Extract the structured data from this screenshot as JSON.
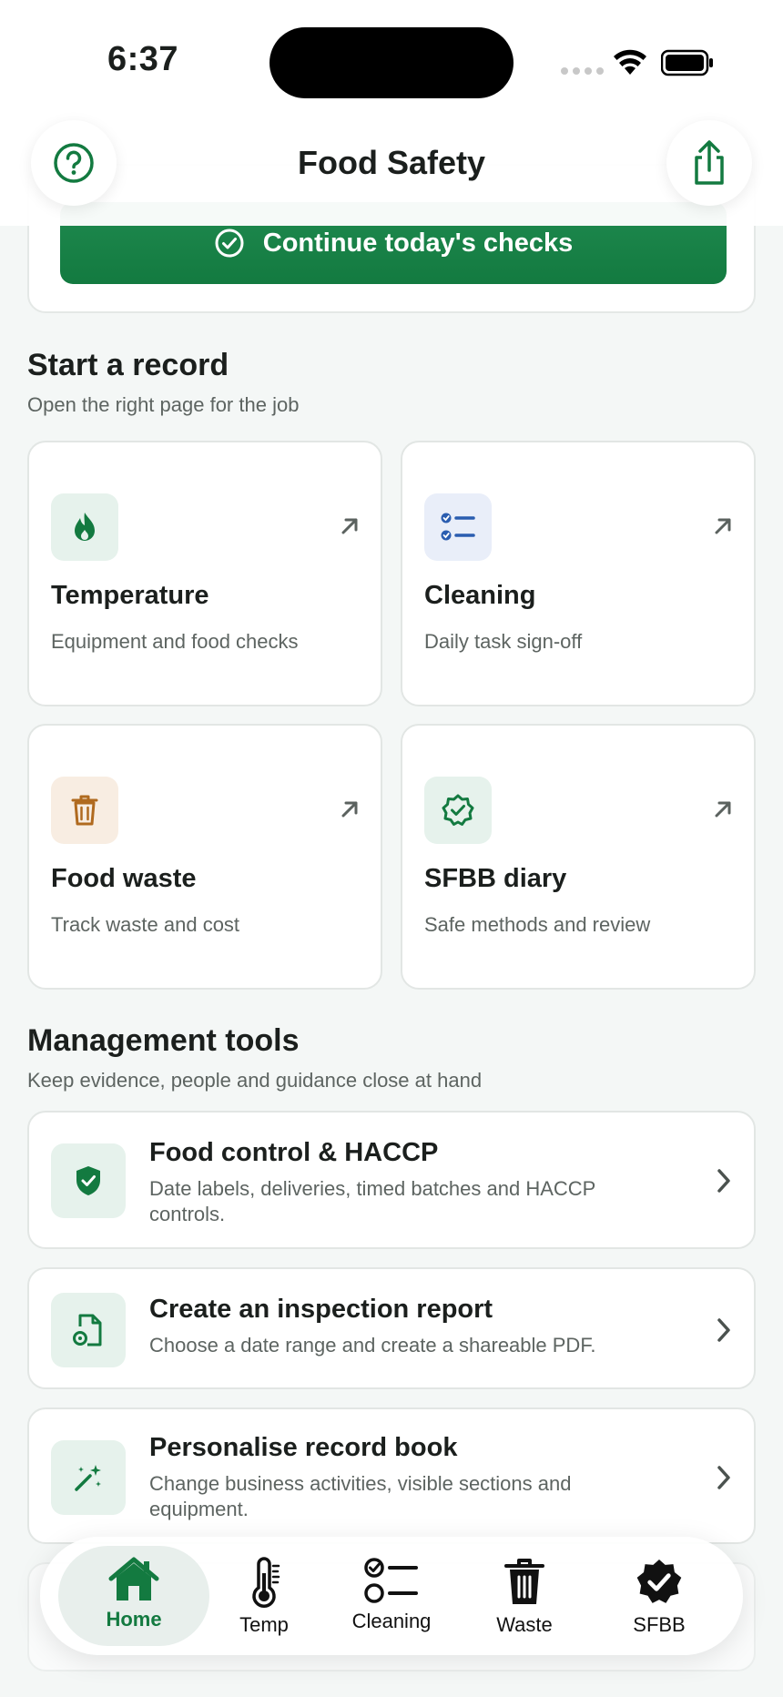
{
  "status": {
    "time": "6:37"
  },
  "header": {
    "title": "Food Safety"
  },
  "top_card": {
    "continue_label": "Continue today's checks"
  },
  "start_section": {
    "title": "Start a record",
    "subtitle": "Open the right page for the job",
    "tiles": [
      {
        "title": "Temperature",
        "subtitle": "Equipment and food checks",
        "icon": "flame-icon",
        "icon_bg": "#e6f2ec",
        "icon_color": "#137a40"
      },
      {
        "title": "Cleaning",
        "subtitle": "Daily task sign-off",
        "icon": "checklist-icon",
        "icon_bg": "#e9eef9",
        "icon_color": "#2a5db0"
      },
      {
        "title": "Food waste",
        "subtitle": "Track waste and cost",
        "icon": "bin-icon",
        "icon_bg": "#f8ede2",
        "icon_color": "#b06a1f"
      },
      {
        "title": "SFBB diary",
        "subtitle": "Safe methods and review",
        "icon": "verified-badge-icon",
        "icon_bg": "#e6f2ec",
        "icon_color": "#137a40"
      }
    ]
  },
  "management": {
    "title": "Management tools",
    "subtitle": "Keep evidence, people and guidance close at hand",
    "items": [
      {
        "title": "Food control & HACCP",
        "desc": "Date labels, deliveries, timed batches and HACCP controls.",
        "icon": "shield-check-icon"
      },
      {
        "title": "Create an inspection report",
        "desc": "Choose a date range and create a shareable PDF.",
        "icon": "document-gear-icon"
      },
      {
        "title": "Personalise record book",
        "desc": "Change business activities, visible sections and equipment.",
        "icon": "magic-wand-icon"
      }
    ]
  },
  "tabbar": {
    "tabs": [
      {
        "label": "Home",
        "icon": "house-icon",
        "active": true
      },
      {
        "label": "Temp",
        "icon": "thermometer-icon",
        "active": false
      },
      {
        "label": "Cleaning",
        "icon": "checklist-icon",
        "active": false
      },
      {
        "label": "Waste",
        "icon": "bin-icon",
        "active": false
      },
      {
        "label": "SFBB",
        "icon": "verified-badge-icon",
        "active": false
      }
    ]
  },
  "colors": {
    "accent": "#137a40",
    "background": "#f4f7f6"
  }
}
